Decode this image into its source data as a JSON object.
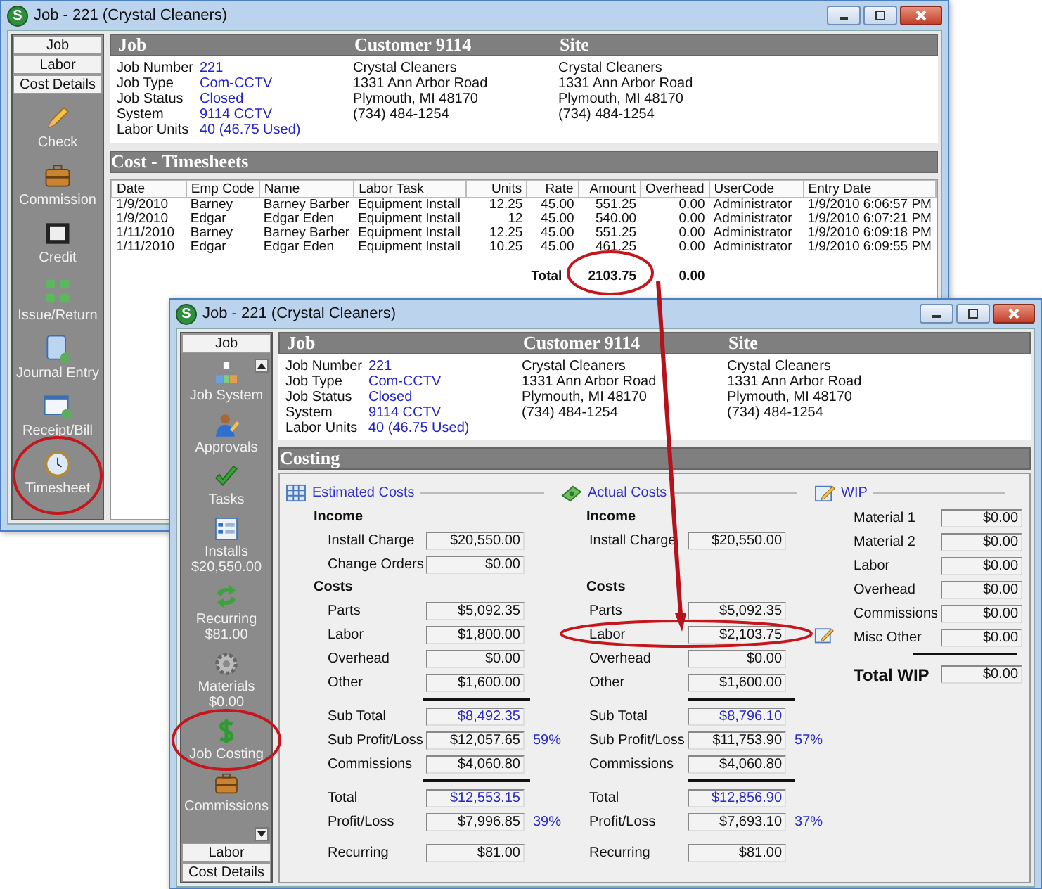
{
  "back_window": {
    "title": "Job - 221 (Crystal Cleaners)",
    "logo_letter": "S",
    "tabs": [
      {
        "label": "Job"
      },
      {
        "label": "Labor"
      },
      {
        "label": "Cost Details"
      }
    ],
    "nav_items": [
      {
        "label": "Check",
        "kind": "pencil"
      },
      {
        "label": "Commission",
        "kind": "briefcase"
      },
      {
        "label": "Credit",
        "kind": "film"
      },
      {
        "label": "Issue/Return",
        "kind": "squares"
      },
      {
        "label": "Journal Entry",
        "kind": "journal"
      },
      {
        "label": "Receipt/Bill",
        "kind": "window"
      },
      {
        "label": "Timesheet",
        "kind": "clock"
      }
    ],
    "header": {
      "job": "Job",
      "customer": "Customer 9114",
      "site": "Site"
    },
    "job_fields": [
      {
        "label": "Job Number",
        "value": "221"
      },
      {
        "label": "Job Type",
        "value": "Com-CCTV"
      },
      {
        "label": "Job Status",
        "value": "Closed"
      },
      {
        "label": "System",
        "value": "9114 CCTV"
      },
      {
        "label": "Labor Units",
        "value": "40 (46.75 Used)"
      }
    ],
    "customer_lines": [
      "Crystal Cleaners",
      "1331 Ann Arbor Road",
      "Plymouth, MI  48170",
      "(734) 484-1254"
    ],
    "site_lines": [
      "Crystal Cleaners",
      "1331 Ann Arbor Road",
      "Plymouth, MI  48170",
      "(734) 484-1254"
    ],
    "section_title": "Cost - Timesheets",
    "table": {
      "columns": [
        "Date",
        "Emp Code",
        "Name",
        "Labor Task",
        "Units",
        "Rate",
        "Amount",
        "Overhead",
        "UserCode",
        "Entry Date"
      ],
      "rows": [
        [
          "1/9/2010",
          "Barney",
          "Barney Barber",
          "Equipment Install",
          "12.25",
          "45.00",
          "551.25",
          "0.00",
          "Administrator",
          "1/9/2010 6:06:57 PM"
        ],
        [
          "1/9/2010",
          "Edgar",
          "Edgar Eden",
          "Equipment Install",
          "12",
          "45.00",
          "540.00",
          "0.00",
          "Administrator",
          "1/9/2010 6:07:21 PM"
        ],
        [
          "1/11/2010",
          "Barney",
          "Barney Barber",
          "Equipment Install",
          "12.25",
          "45.00",
          "551.25",
          "0.00",
          "Administrator",
          "1/9/2010 6:09:18 PM"
        ],
        [
          "1/11/2010",
          "Edgar",
          "Edgar Eden",
          "Equipment Install",
          "10.25",
          "45.00",
          "461.25",
          "0.00",
          "Administrator",
          "1/9/2010 6:09:55 PM"
        ]
      ],
      "total": {
        "label": "Total",
        "amount": "2103.75",
        "overhead": "0.00"
      }
    }
  },
  "front_window": {
    "title": "Job - 221 (Crystal Cleaners)",
    "logo_letter": "S",
    "top_tabs": [
      {
        "label": "Job"
      }
    ],
    "nav_items": [
      {
        "label": "Job System",
        "kind": "orgchart"
      },
      {
        "label": "Approvals",
        "kind": "person"
      },
      {
        "label": "Tasks",
        "kind": "check"
      },
      {
        "label": "Installs",
        "detail": "$20,550.00",
        "kind": "list"
      },
      {
        "label": "Recurring",
        "detail": "$81.00",
        "kind": "cycle"
      },
      {
        "label": "Materials",
        "detail": "$0.00",
        "kind": "gear"
      },
      {
        "label": "Job Costing",
        "kind": "dollar"
      },
      {
        "label": "Commissions",
        "kind": "briefcase"
      }
    ],
    "bottom_tabs": [
      {
        "label": "Labor"
      },
      {
        "label": "Cost Details"
      }
    ],
    "header": {
      "job": "Job",
      "customer": "Customer 9114",
      "site": "Site"
    },
    "job_fields": [
      {
        "label": "Job Number",
        "value": "221"
      },
      {
        "label": "Job Type",
        "value": "Com-CCTV"
      },
      {
        "label": "Job Status",
        "value": "Closed"
      },
      {
        "label": "System",
        "value": "9114 CCTV"
      },
      {
        "label": "Labor Units",
        "value": "40 (46.75 Used)"
      }
    ],
    "customer_lines": [
      "Crystal Cleaners",
      "1331 Ann Arbor Road",
      "Plymouth, MI  48170",
      "(734) 484-1254"
    ],
    "site_lines": [
      "Crystal Cleaners",
      "1331 Ann Arbor Road",
      "Plymouth, MI  48170",
      "(734) 484-1254"
    ],
    "costing": {
      "title": "Costing",
      "columns": [
        {
          "title": "Estimated Costs",
          "sections": [
            {
              "heading": "Income",
              "rows": [
                {
                  "label": "Install Charge",
                  "value": "$20,550.00"
                },
                {
                  "label": "Change Orders",
                  "value": "$0.00"
                }
              ]
            },
            {
              "heading": "Costs",
              "rows": [
                {
                  "label": "Parts",
                  "value": "$5,092.35"
                },
                {
                  "label": "Labor",
                  "value": "$1,800.00"
                },
                {
                  "label": "Overhead",
                  "value": "$0.00"
                },
                {
                  "label": "Other",
                  "value": "$1,600.00"
                }
              ]
            }
          ],
          "subtotals": [
            {
              "label": "Sub Total",
              "value": "$8,492.35",
              "kind": "computed"
            },
            {
              "label": "Sub Profit/Loss",
              "value": "$12,057.65",
              "percent": "59%",
              "kind": "plain"
            },
            {
              "label": "Commissions",
              "value": "$4,060.80",
              "kind": "plain"
            }
          ],
          "totals": [
            {
              "label": "Total",
              "value": "$12,553.15",
              "kind": "computed"
            },
            {
              "label": "Profit/Loss",
              "value": "$7,996.85",
              "percent": "39%",
              "kind": "plain"
            }
          ],
          "recurring": {
            "label": "Recurring",
            "value": "$81.00"
          }
        },
        {
          "title": "Actual Costs",
          "sections": [
            {
              "heading": "Income",
              "rows": [
                {
                  "label": "Install Charge",
                  "value": "$20,550.00"
                }
              ]
            },
            {
              "heading": "Costs",
              "rows": [
                {
                  "label": "Parts",
                  "value": "$5,092.35",
                  "editable": false
                },
                {
                  "label": "Labor",
                  "value": "$2,103.75",
                  "editable": true
                },
                {
                  "label": "Overhead",
                  "value": "$0.00",
                  "editable": false
                },
                {
                  "label": "Other",
                  "value": "$1,600.00",
                  "editable": false
                }
              ]
            }
          ],
          "subtotals": [
            {
              "label": "Sub Total",
              "value": "$8,796.10",
              "kind": "computed"
            },
            {
              "label": "Sub Profit/Loss",
              "value": "$11,753.90",
              "percent": "57%",
              "kind": "plain"
            },
            {
              "label": "Commissions",
              "value": "$4,060.80",
              "kind": "plain"
            }
          ],
          "totals": [
            {
              "label": "Total",
              "value": "$12,856.90",
              "kind": "computed"
            },
            {
              "label": "Profit/Loss",
              "value": "$7,693.10",
              "percent": "37%",
              "kind": "plain"
            }
          ],
          "recurring": {
            "label": "Recurring",
            "value": "$81.00"
          }
        }
      ],
      "wip": {
        "title": "WIP",
        "rows": [
          {
            "label": "Material 1",
            "value": "$0.00"
          },
          {
            "label": "Material 2",
            "value": "$0.00"
          },
          {
            "label": "Labor",
            "value": "$0.00"
          },
          {
            "label": "Overhead",
            "value": "$0.00"
          },
          {
            "label": "Commissions",
            "value": "$0.00"
          },
          {
            "label": "Misc Other",
            "value": "$0.00"
          }
        ],
        "total": {
          "label": "Total WIP",
          "value": "$0.00"
        }
      }
    }
  }
}
